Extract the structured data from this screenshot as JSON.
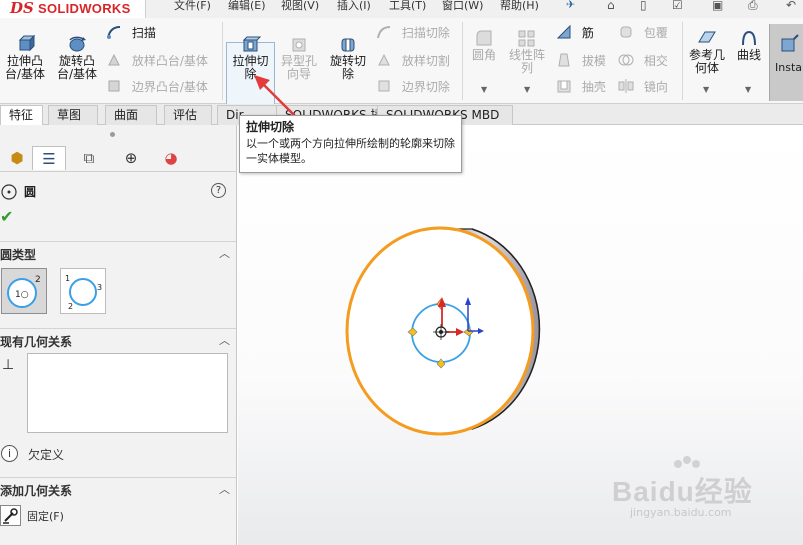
{
  "app": {
    "logo_ds": "DS",
    "logo_name": "SOLIDWORKS"
  },
  "menu": {
    "items": [
      "文件(F)",
      "编辑(E)",
      "视图(V)",
      "插入(I)",
      "工具(T)",
      "窗口(W)",
      "帮助(H)"
    ]
  },
  "ribbon": {
    "extrude_boss": "拉伸凸\n台/基体",
    "revolve_boss": "旋转凸\n台/基体",
    "sweep": "扫描",
    "loft": "放样凸台/基体",
    "boundary_boss": "边界凸台/基体",
    "extrude_cut": "拉伸切\n除",
    "hole_wizard": "异型孔\n向导",
    "revolve_cut": "旋转切\n除",
    "swept_cut": "扫描切除",
    "lofted_cut": "放样切割",
    "boundary_cut": "边界切除",
    "fillet": "圆角",
    "linear_pattern": "线性阵\n列",
    "rib": "筋",
    "draft": "拔模",
    "shell": "抽壳",
    "wrap": "包覆",
    "intersect": "相交",
    "mirror": "镜向",
    "reference_geometry": "参考几\n何体",
    "curves": "曲线",
    "instant3d": "Instan"
  },
  "tabs": [
    "特征",
    "草图",
    "曲面",
    "评估",
    "Dir",
    "SOLIDWORKS 插件",
    "SOLIDWORKS MBD"
  ],
  "tooltip": {
    "title": "拉伸切除",
    "description": "以一个或两个方向拉伸所绘制的轮廓来切除一实体模型。"
  },
  "panel": {
    "title": "圆",
    "circle_type_header": "圆类型",
    "existing_relations_header": "现有几何关系",
    "status": "欠定义",
    "add_relations_header": "添加几何关系",
    "fix_label": "固定(F)"
  },
  "watermark": {
    "brand": "Baidu经验",
    "url": "jingyan.baidu.com"
  },
  "colors": {
    "accent": "#f39c1f",
    "sketch_blue": "#3aa0e6",
    "logo_red": "#d9252a"
  }
}
